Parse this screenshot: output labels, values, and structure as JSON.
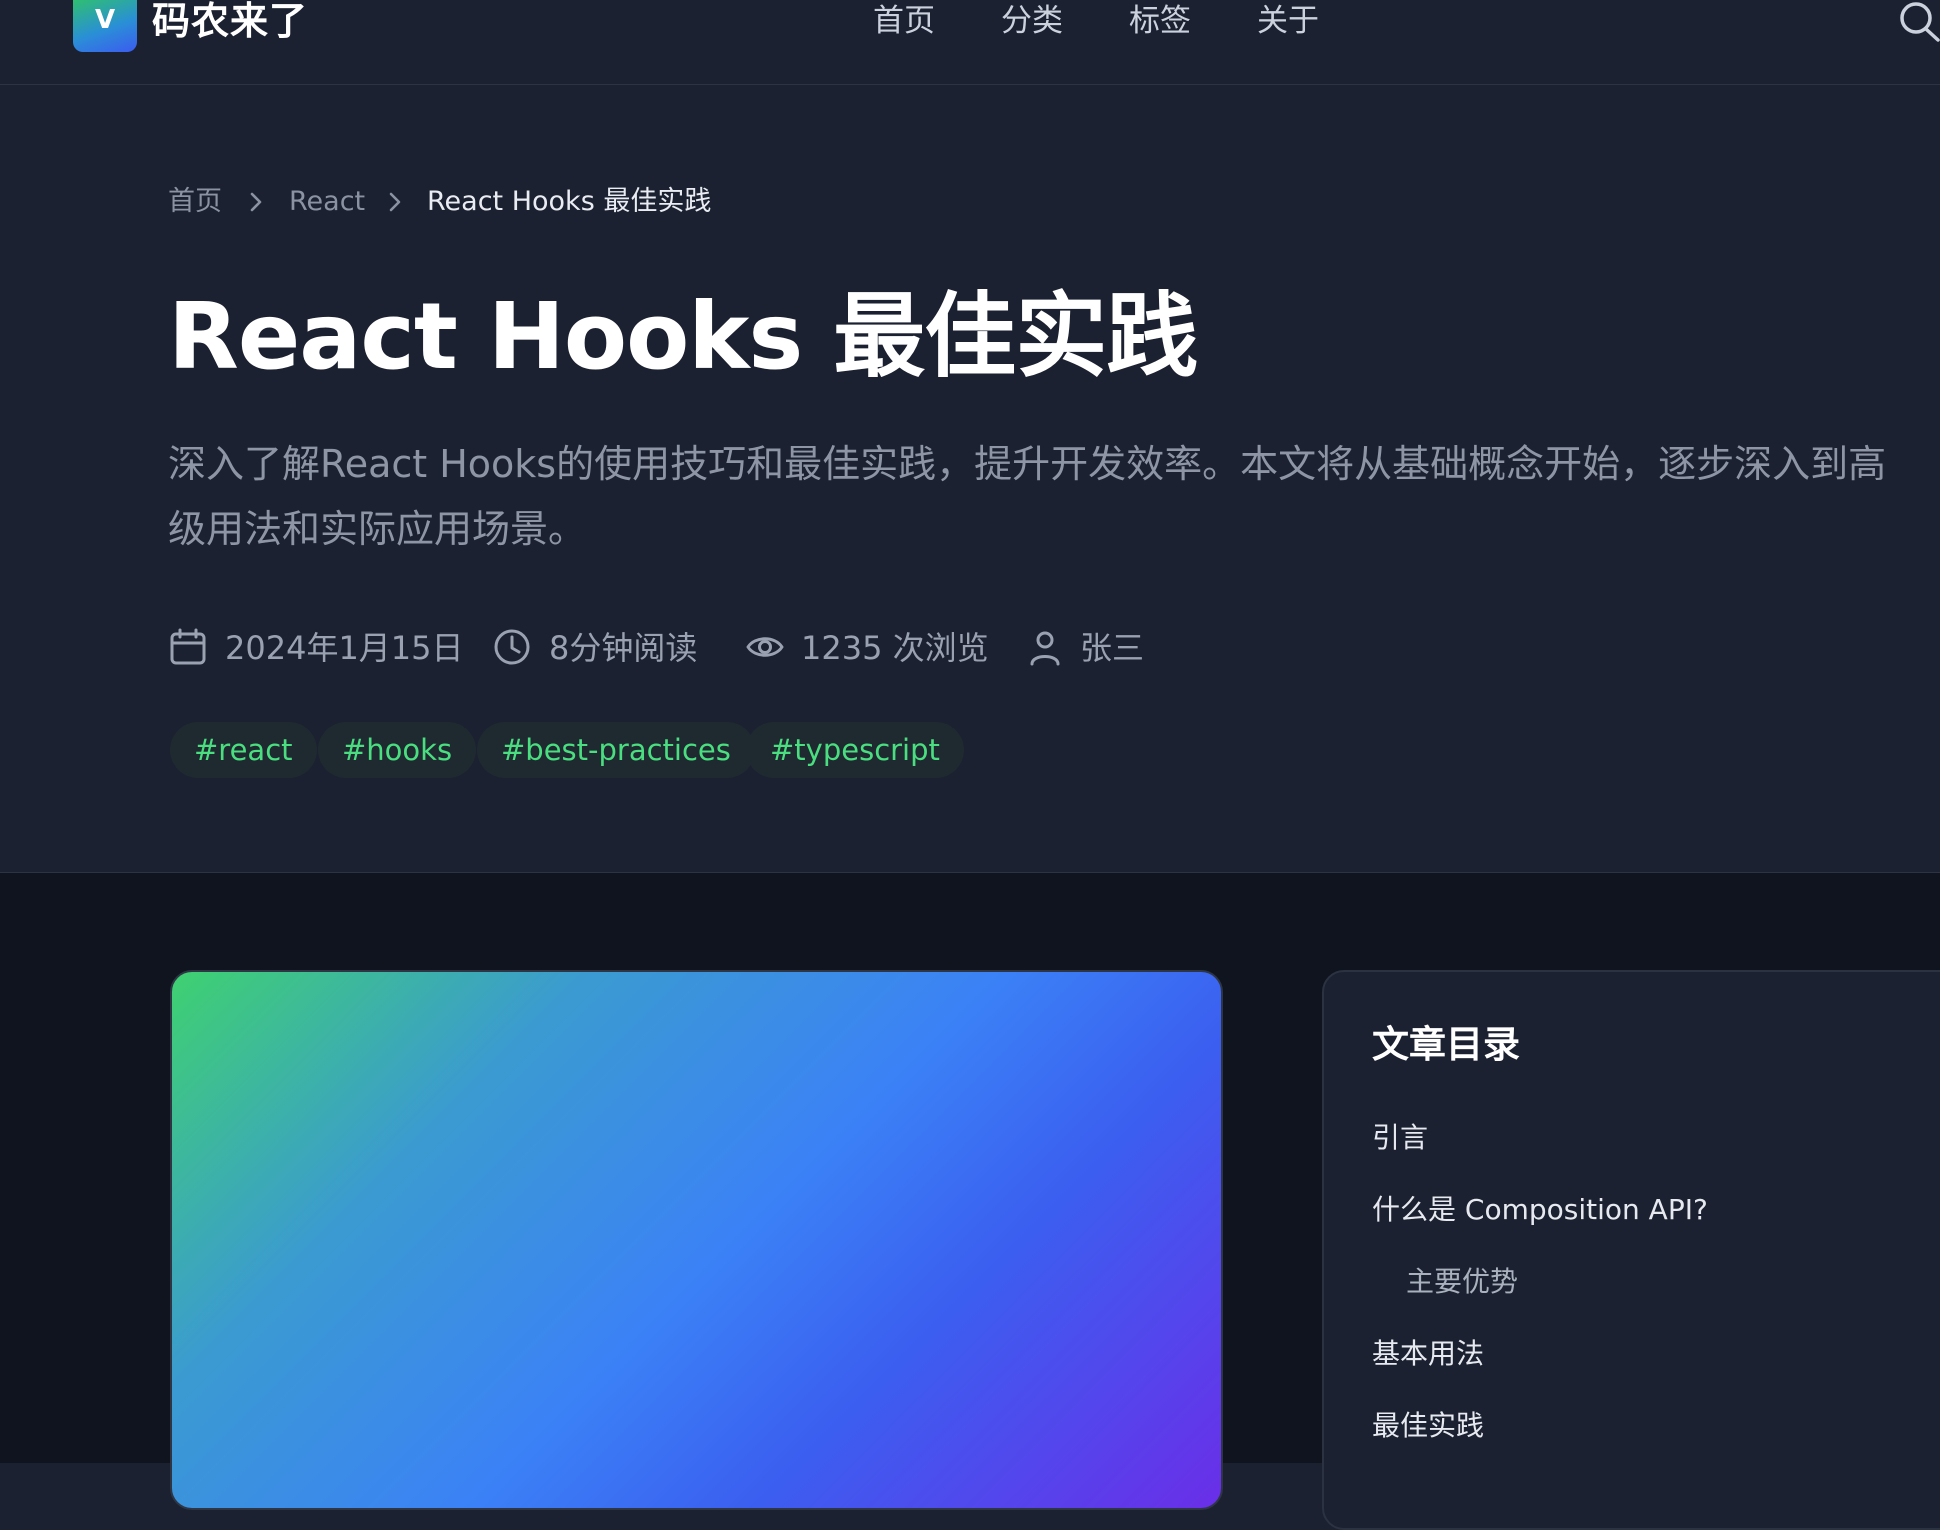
{
  "header": {
    "logo_letter": "V",
    "site_name": "码农来了",
    "nav": [
      "首页",
      "分类",
      "标签",
      "关于"
    ]
  },
  "breadcrumb": [
    "首页",
    "React",
    "React Hooks 最佳实践"
  ],
  "article": {
    "title": "React Hooks 最佳实践",
    "description_line1": "深入了解React Hooks的使用技巧和最佳实践，提升开发效率。本文将从基础概念开始，逐步深入到高",
    "description_line2": "级用法和实际应用场景。",
    "meta": {
      "date": "2024年1月15日",
      "read_time": "8分钟阅读",
      "views": "1235 次浏览",
      "author": "张三"
    },
    "tags": [
      "#react",
      "#hooks",
      "#best-practices",
      "#typescript"
    ]
  },
  "toc": {
    "title": "文章目录",
    "items": [
      {
        "label": "引言",
        "level": 1
      },
      {
        "label": "什么是 Composition API?",
        "level": 1
      },
      {
        "label": "主要优势",
        "level": 2
      },
      {
        "label": "基本用法",
        "level": 1
      },
      {
        "label": "最佳实践",
        "level": 1
      }
    ]
  },
  "colors": {
    "page_bg": "#1b2130",
    "lower_bg": "#0f141f",
    "tag_text": "#4ade80",
    "muted_text": "#8e96a6"
  },
  "icons": [
    "search-icon",
    "calendar-icon",
    "clock-icon",
    "eye-icon",
    "user-icon",
    "chevron-right-icon"
  ]
}
